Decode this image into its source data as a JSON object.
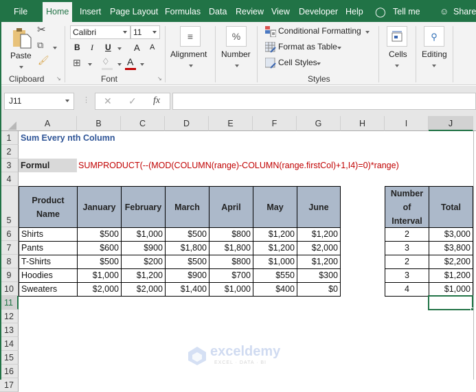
{
  "tabs": [
    {
      "label": "File"
    },
    {
      "label": "Home",
      "active": true
    },
    {
      "label": "Insert"
    },
    {
      "label": "Page Layout"
    },
    {
      "label": "Formulas"
    },
    {
      "label": "Data"
    },
    {
      "label": "Review"
    },
    {
      "label": "View"
    },
    {
      "label": "Developer"
    },
    {
      "label": "Help"
    },
    {
      "label": "Tell me"
    },
    {
      "label": "Share"
    }
  ],
  "ribbon": {
    "clipboard": {
      "paste": "Paste",
      "label": "Clipboard"
    },
    "font": {
      "name": "Calibri",
      "size": "11",
      "label": "Font",
      "bold": "B",
      "italic": "I",
      "underline": "U",
      "grow": "A",
      "shrink": "A",
      "fontcolor": "A"
    },
    "alignment": {
      "label": "Alignment"
    },
    "number": {
      "label": "Number",
      "icon": "%"
    },
    "styles": {
      "conditional": "Conditional Formatting",
      "table": "Format as Table",
      "cellstyles": "Cell Styles",
      "label": "Styles"
    },
    "cells": {
      "label": "Cells"
    },
    "editing": {
      "label": "Editing"
    }
  },
  "formula_bar": {
    "name_box": "J11",
    "fx": "fx",
    "value": ""
  },
  "columns": [
    "A",
    "B",
    "C",
    "D",
    "E",
    "F",
    "G",
    "H",
    "I",
    "J"
  ],
  "selected_column": "J",
  "rows": [
    "1",
    "2",
    "3",
    "4",
    "5",
    "6",
    "7",
    "8",
    "9",
    "10",
    "11",
    "12",
    "13",
    "14",
    "15",
    "16",
    "17"
  ],
  "selected_row": "11",
  "sheet": {
    "title": "Sum Every nth Column",
    "formula_label": "Formul",
    "formula_text": "SUMPRODUCT(--(MOD(COLUMN(range)-COLUMN(range.firstCol)+1,I4)=0)*range)",
    "headers": [
      "Product Name",
      "January",
      "February",
      "March",
      "April",
      "May",
      "June"
    ],
    "data": [
      [
        "Shirts",
        "$500",
        "$1,000",
        "$500",
        "$800",
        "$1,200",
        "$1,200"
      ],
      [
        "Pants",
        "$600",
        "$900",
        "$1,800",
        "$1,800",
        "$1,200",
        "$2,000"
      ],
      [
        "T-Shirts",
        "$500",
        "$200",
        "$500",
        "$800",
        "$1,000",
        "$1,200"
      ],
      [
        "Hoodies",
        "$1,000",
        "$1,200",
        "$900",
        "$700",
        "$550",
        "$300"
      ],
      [
        "Sweaters",
        "$2,000",
        "$2,000",
        "$1,400",
        "$1,000",
        "$400",
        "$0"
      ]
    ],
    "side_headers": [
      "Number of Interval",
      "Total"
    ],
    "side_data": [
      [
        "2",
        "$3,000"
      ],
      [
        "3",
        "$3,800"
      ],
      [
        "2",
        "$2,200"
      ],
      [
        "3",
        "$1,200"
      ],
      [
        "4",
        "$1,000"
      ]
    ]
  },
  "watermark": {
    "brand": "exceldemy",
    "tagline": "EXCEL · DATA · BI"
  },
  "colors": {
    "excel_green": "#217346",
    "header_fill": "#acb9ca",
    "title_blue": "#2f5597",
    "formula_red": "#c00000"
  }
}
